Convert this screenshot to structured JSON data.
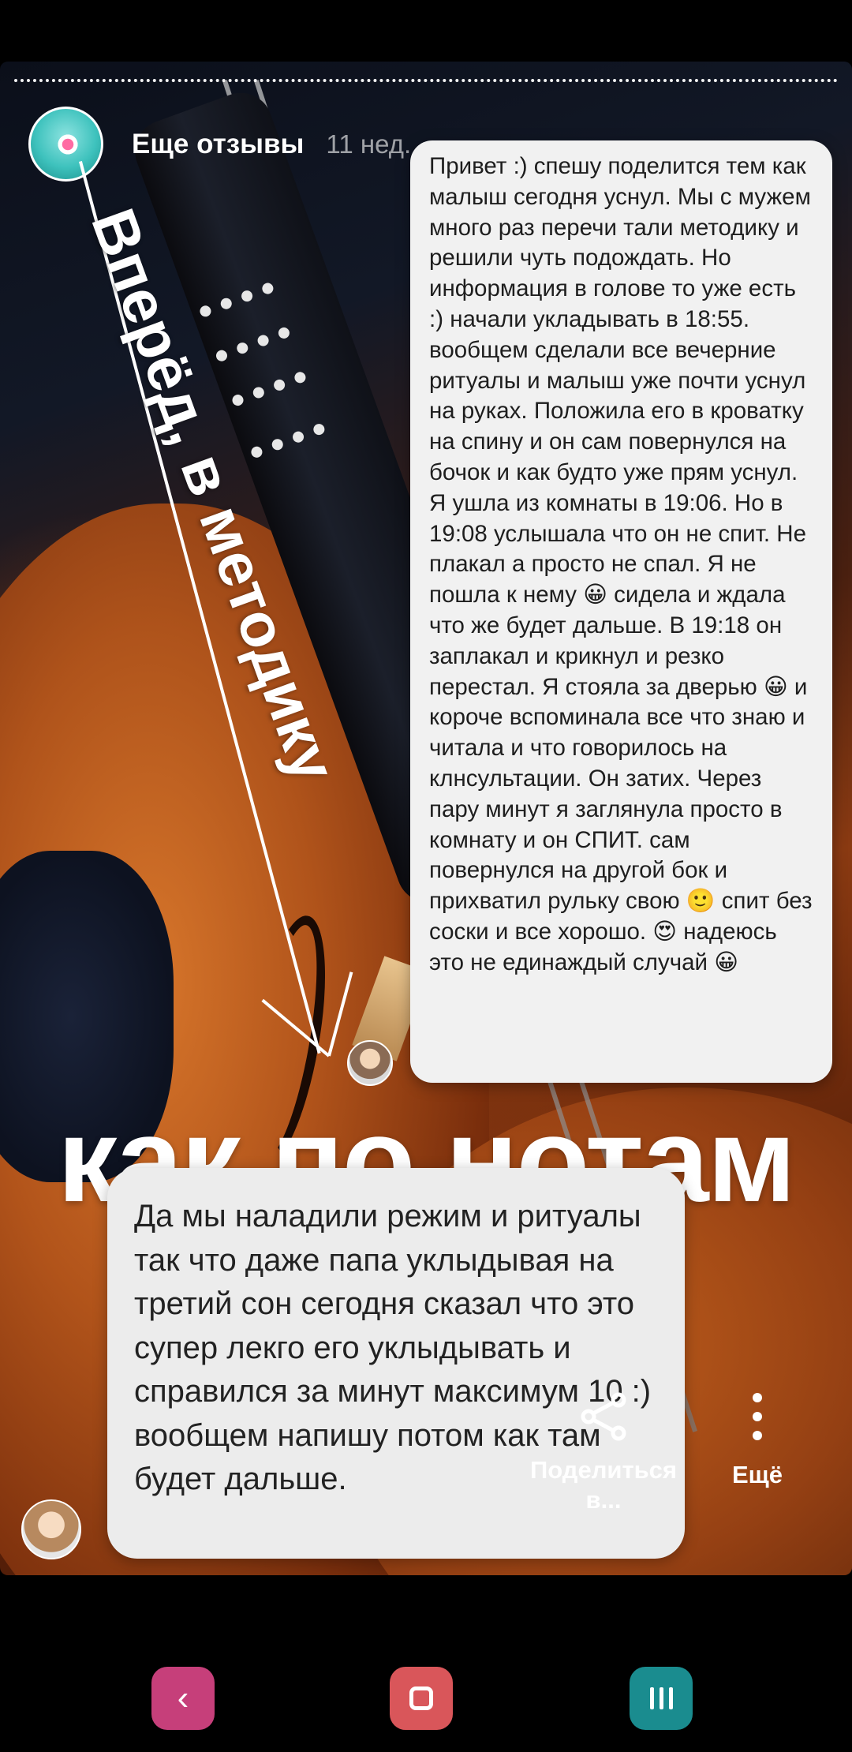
{
  "story": {
    "account_name": "Еще отзывы",
    "posted_ago": "11 нед.",
    "rotated_caption": "Вперёд, в методику",
    "big_caption": "как по нотам"
  },
  "message_1": {
    "text": "Привет :) спешу поделится тем как малыш сегодня уснул. Мы с мужем много раз перечи тали методику и решили чуть подождать. Но информация в голове то уже есть :) начали укладывать в 18:55. вообщем сделали все вечерние ритуалы и малыш уже почти уснул на руках. Положила его в кроватку на спину и он сам повернулся на бочок и как будто уже прям уснул. Я ушла из комнаты в 19:06. Но в 19:08 услышала что он не спит. Не плакал а просто не спал. Я не пошла к нему 😀 сидела и ждала что же будет дальше. В 19:18 он заплакал и крикнул и резко перестал. Я стояла за дверью 😀 и короче вспоминала все что знаю и читала и что говорилось на клнсультации. Он затих. Через пару минут я заглянула просто в комнату и он СПИТ. сам повернулся на другой бок и прихватил рульку свою 🙂 спит без соски и все хорошо. 😍 надеюсь это не единаждый случай 😀"
  },
  "message_2": {
    "text": "Да мы наладили режим и ритуалы так что даже папа уклыдывая на третий сон сегодня сказал что это супер лекго его уклыдывать и справился за минут максимум 10 :) вообщем напишу потом как там будет дальше."
  },
  "actions": {
    "share_label": "Поделиться в...",
    "more_label": "Ещё"
  },
  "icons": {
    "share": "share-icon",
    "more": "more-vertical-icon",
    "back": "back-icon",
    "home": "home-icon",
    "recent": "recent-apps-icon"
  },
  "colors": {
    "nav_back": "#c63f7a",
    "nav_home": "#d9565a",
    "nav_recent": "#1a8c8f"
  }
}
